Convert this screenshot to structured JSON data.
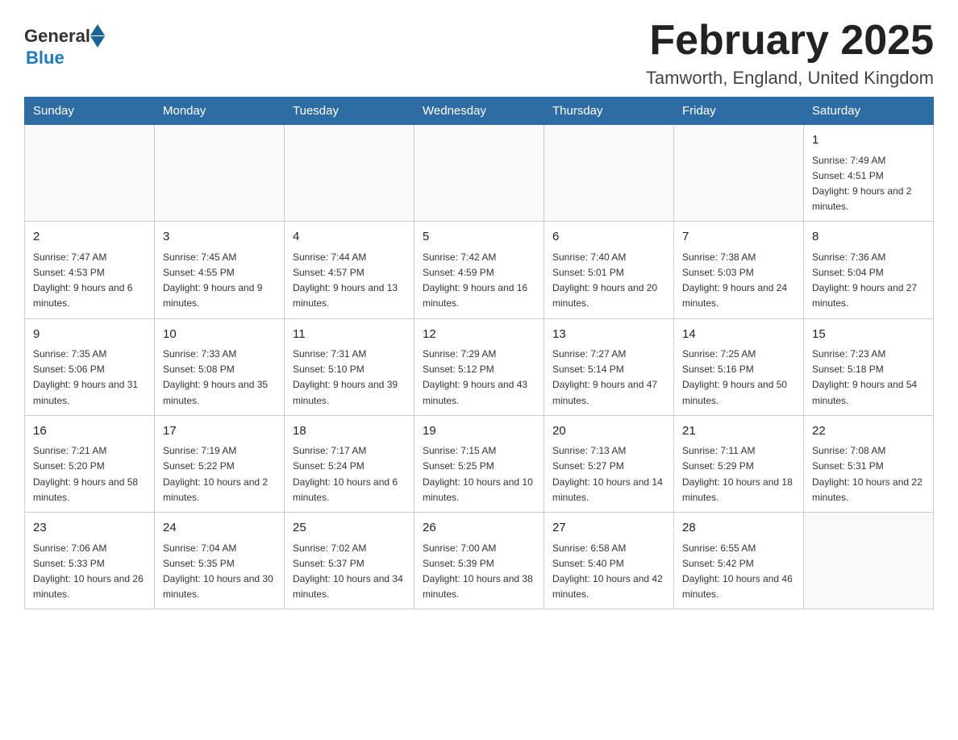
{
  "header": {
    "title": "February 2025",
    "subtitle": "Tamworth, England, United Kingdom",
    "logo_general": "General",
    "logo_blue": "Blue"
  },
  "days_of_week": [
    "Sunday",
    "Monday",
    "Tuesday",
    "Wednesday",
    "Thursday",
    "Friday",
    "Saturday"
  ],
  "weeks": [
    [
      {
        "day": "",
        "info": ""
      },
      {
        "day": "",
        "info": ""
      },
      {
        "day": "",
        "info": ""
      },
      {
        "day": "",
        "info": ""
      },
      {
        "day": "",
        "info": ""
      },
      {
        "day": "",
        "info": ""
      },
      {
        "day": "1",
        "info": "Sunrise: 7:49 AM\nSunset: 4:51 PM\nDaylight: 9 hours and 2 minutes."
      }
    ],
    [
      {
        "day": "2",
        "info": "Sunrise: 7:47 AM\nSunset: 4:53 PM\nDaylight: 9 hours and 6 minutes."
      },
      {
        "day": "3",
        "info": "Sunrise: 7:45 AM\nSunset: 4:55 PM\nDaylight: 9 hours and 9 minutes."
      },
      {
        "day": "4",
        "info": "Sunrise: 7:44 AM\nSunset: 4:57 PM\nDaylight: 9 hours and 13 minutes."
      },
      {
        "day": "5",
        "info": "Sunrise: 7:42 AM\nSunset: 4:59 PM\nDaylight: 9 hours and 16 minutes."
      },
      {
        "day": "6",
        "info": "Sunrise: 7:40 AM\nSunset: 5:01 PM\nDaylight: 9 hours and 20 minutes."
      },
      {
        "day": "7",
        "info": "Sunrise: 7:38 AM\nSunset: 5:03 PM\nDaylight: 9 hours and 24 minutes."
      },
      {
        "day": "8",
        "info": "Sunrise: 7:36 AM\nSunset: 5:04 PM\nDaylight: 9 hours and 27 minutes."
      }
    ],
    [
      {
        "day": "9",
        "info": "Sunrise: 7:35 AM\nSunset: 5:06 PM\nDaylight: 9 hours and 31 minutes."
      },
      {
        "day": "10",
        "info": "Sunrise: 7:33 AM\nSunset: 5:08 PM\nDaylight: 9 hours and 35 minutes."
      },
      {
        "day": "11",
        "info": "Sunrise: 7:31 AM\nSunset: 5:10 PM\nDaylight: 9 hours and 39 minutes."
      },
      {
        "day": "12",
        "info": "Sunrise: 7:29 AM\nSunset: 5:12 PM\nDaylight: 9 hours and 43 minutes."
      },
      {
        "day": "13",
        "info": "Sunrise: 7:27 AM\nSunset: 5:14 PM\nDaylight: 9 hours and 47 minutes."
      },
      {
        "day": "14",
        "info": "Sunrise: 7:25 AM\nSunset: 5:16 PM\nDaylight: 9 hours and 50 minutes."
      },
      {
        "day": "15",
        "info": "Sunrise: 7:23 AM\nSunset: 5:18 PM\nDaylight: 9 hours and 54 minutes."
      }
    ],
    [
      {
        "day": "16",
        "info": "Sunrise: 7:21 AM\nSunset: 5:20 PM\nDaylight: 9 hours and 58 minutes."
      },
      {
        "day": "17",
        "info": "Sunrise: 7:19 AM\nSunset: 5:22 PM\nDaylight: 10 hours and 2 minutes."
      },
      {
        "day": "18",
        "info": "Sunrise: 7:17 AM\nSunset: 5:24 PM\nDaylight: 10 hours and 6 minutes."
      },
      {
        "day": "19",
        "info": "Sunrise: 7:15 AM\nSunset: 5:25 PM\nDaylight: 10 hours and 10 minutes."
      },
      {
        "day": "20",
        "info": "Sunrise: 7:13 AM\nSunset: 5:27 PM\nDaylight: 10 hours and 14 minutes."
      },
      {
        "day": "21",
        "info": "Sunrise: 7:11 AM\nSunset: 5:29 PM\nDaylight: 10 hours and 18 minutes."
      },
      {
        "day": "22",
        "info": "Sunrise: 7:08 AM\nSunset: 5:31 PM\nDaylight: 10 hours and 22 minutes."
      }
    ],
    [
      {
        "day": "23",
        "info": "Sunrise: 7:06 AM\nSunset: 5:33 PM\nDaylight: 10 hours and 26 minutes."
      },
      {
        "day": "24",
        "info": "Sunrise: 7:04 AM\nSunset: 5:35 PM\nDaylight: 10 hours and 30 minutes."
      },
      {
        "day": "25",
        "info": "Sunrise: 7:02 AM\nSunset: 5:37 PM\nDaylight: 10 hours and 34 minutes."
      },
      {
        "day": "26",
        "info": "Sunrise: 7:00 AM\nSunset: 5:39 PM\nDaylight: 10 hours and 38 minutes."
      },
      {
        "day": "27",
        "info": "Sunrise: 6:58 AM\nSunset: 5:40 PM\nDaylight: 10 hours and 42 minutes."
      },
      {
        "day": "28",
        "info": "Sunrise: 6:55 AM\nSunset: 5:42 PM\nDaylight: 10 hours and 46 minutes."
      },
      {
        "day": "",
        "info": ""
      }
    ]
  ]
}
